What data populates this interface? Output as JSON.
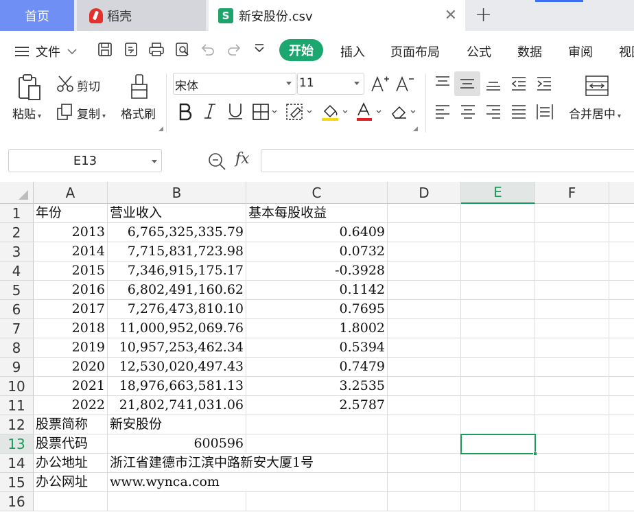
{
  "tabs": {
    "home": "首页",
    "daoke": "稻壳",
    "file_logo": "S",
    "file": "新安股份.csv"
  },
  "menu": {
    "file": "文件",
    "start": "开始",
    "insert": "插入",
    "layout": "页面布局",
    "formula": "公式",
    "data": "数据",
    "review": "审阅",
    "view": "视图"
  },
  "ribbon": {
    "paste": "粘贴",
    "cut": "剪切",
    "copy": "复制",
    "format_painter": "格式刷",
    "font_name": "宋体",
    "font_size": "11",
    "merge_center": "合并居中"
  },
  "formula_bar": {
    "name_box": "E13",
    "fx": "fx",
    "value": ""
  },
  "sheet": {
    "columns": [
      "A",
      "B",
      "C",
      "D",
      "E",
      "F"
    ],
    "active_column": "E",
    "active_row": "13",
    "rows": [
      {
        "n": "1",
        "a": "年份",
        "b": "营业收入",
        "c": "基本每股收益"
      },
      {
        "n": "2",
        "a": "2013",
        "b": "6,765,325,335.79",
        "c": "0.6409"
      },
      {
        "n": "3",
        "a": "2014",
        "b": "7,715,831,723.98",
        "c": "0.0732"
      },
      {
        "n": "4",
        "a": "2015",
        "b": "7,346,915,175.17",
        "c": "-0.3928"
      },
      {
        "n": "5",
        "a": "2016",
        "b": "6,802,491,160.62",
        "c": "0.1142"
      },
      {
        "n": "6",
        "a": "2017",
        "b": "7,276,473,810.10",
        "c": "0.7695"
      },
      {
        "n": "7",
        "a": "2018",
        "b": "11,000,952,069.76",
        "c": "1.8002"
      },
      {
        "n": "8",
        "a": "2019",
        "b": "10,957,253,462.34",
        "c": "0.5394"
      },
      {
        "n": "9",
        "a": "2020",
        "b": "12,530,020,497.43",
        "c": "0.7479"
      },
      {
        "n": "10",
        "a": "2021",
        "b": "18,976,663,581.13",
        "c": "3.2535"
      },
      {
        "n": "11",
        "a": "2022",
        "b": "21,802,741,031.06",
        "c": "2.5787"
      },
      {
        "n": "12",
        "a": "股票简称",
        "b": "新安股份",
        "c": ""
      },
      {
        "n": "13",
        "a": "股票代码",
        "b": "600596",
        "c": ""
      },
      {
        "n": "14",
        "a": "办公地址",
        "b": "浙江省建德市江滨中路新安大厦1号",
        "c": ""
      },
      {
        "n": "15",
        "a": "办公网址",
        "b": "www.wynca.com",
        "c": ""
      },
      {
        "n": "16",
        "a": "",
        "b": "",
        "c": ""
      }
    ]
  },
  "colors": {
    "accent_green": "#1ca770",
    "home_tab": "#6f8ff5",
    "selection": "#1a9b5a"
  }
}
